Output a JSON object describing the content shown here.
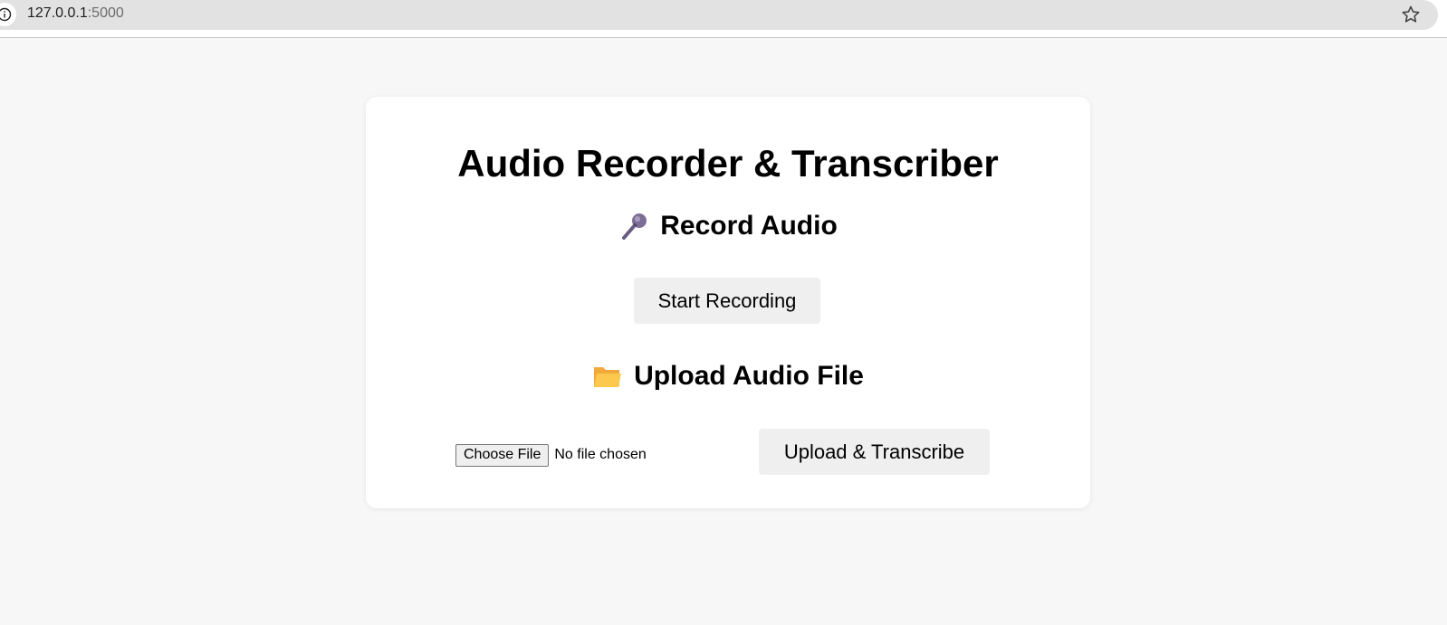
{
  "browser": {
    "url_host": "127.0.0.1",
    "url_port": ":5000"
  },
  "card": {
    "title": "Audio Recorder & Transcriber",
    "record": {
      "heading": "Record Audio",
      "icon": "microphone-icon",
      "button_label": "Start Recording"
    },
    "upload": {
      "heading": "Upload Audio File",
      "icon": "folder-icon",
      "choose_label": "Choose File",
      "file_status": "No file chosen",
      "button_label": "Upload & Transcribe"
    }
  },
  "colors": {
    "page_background": "#f7f7f7",
    "card_background": "#ffffff",
    "button_background": "#efefef"
  }
}
